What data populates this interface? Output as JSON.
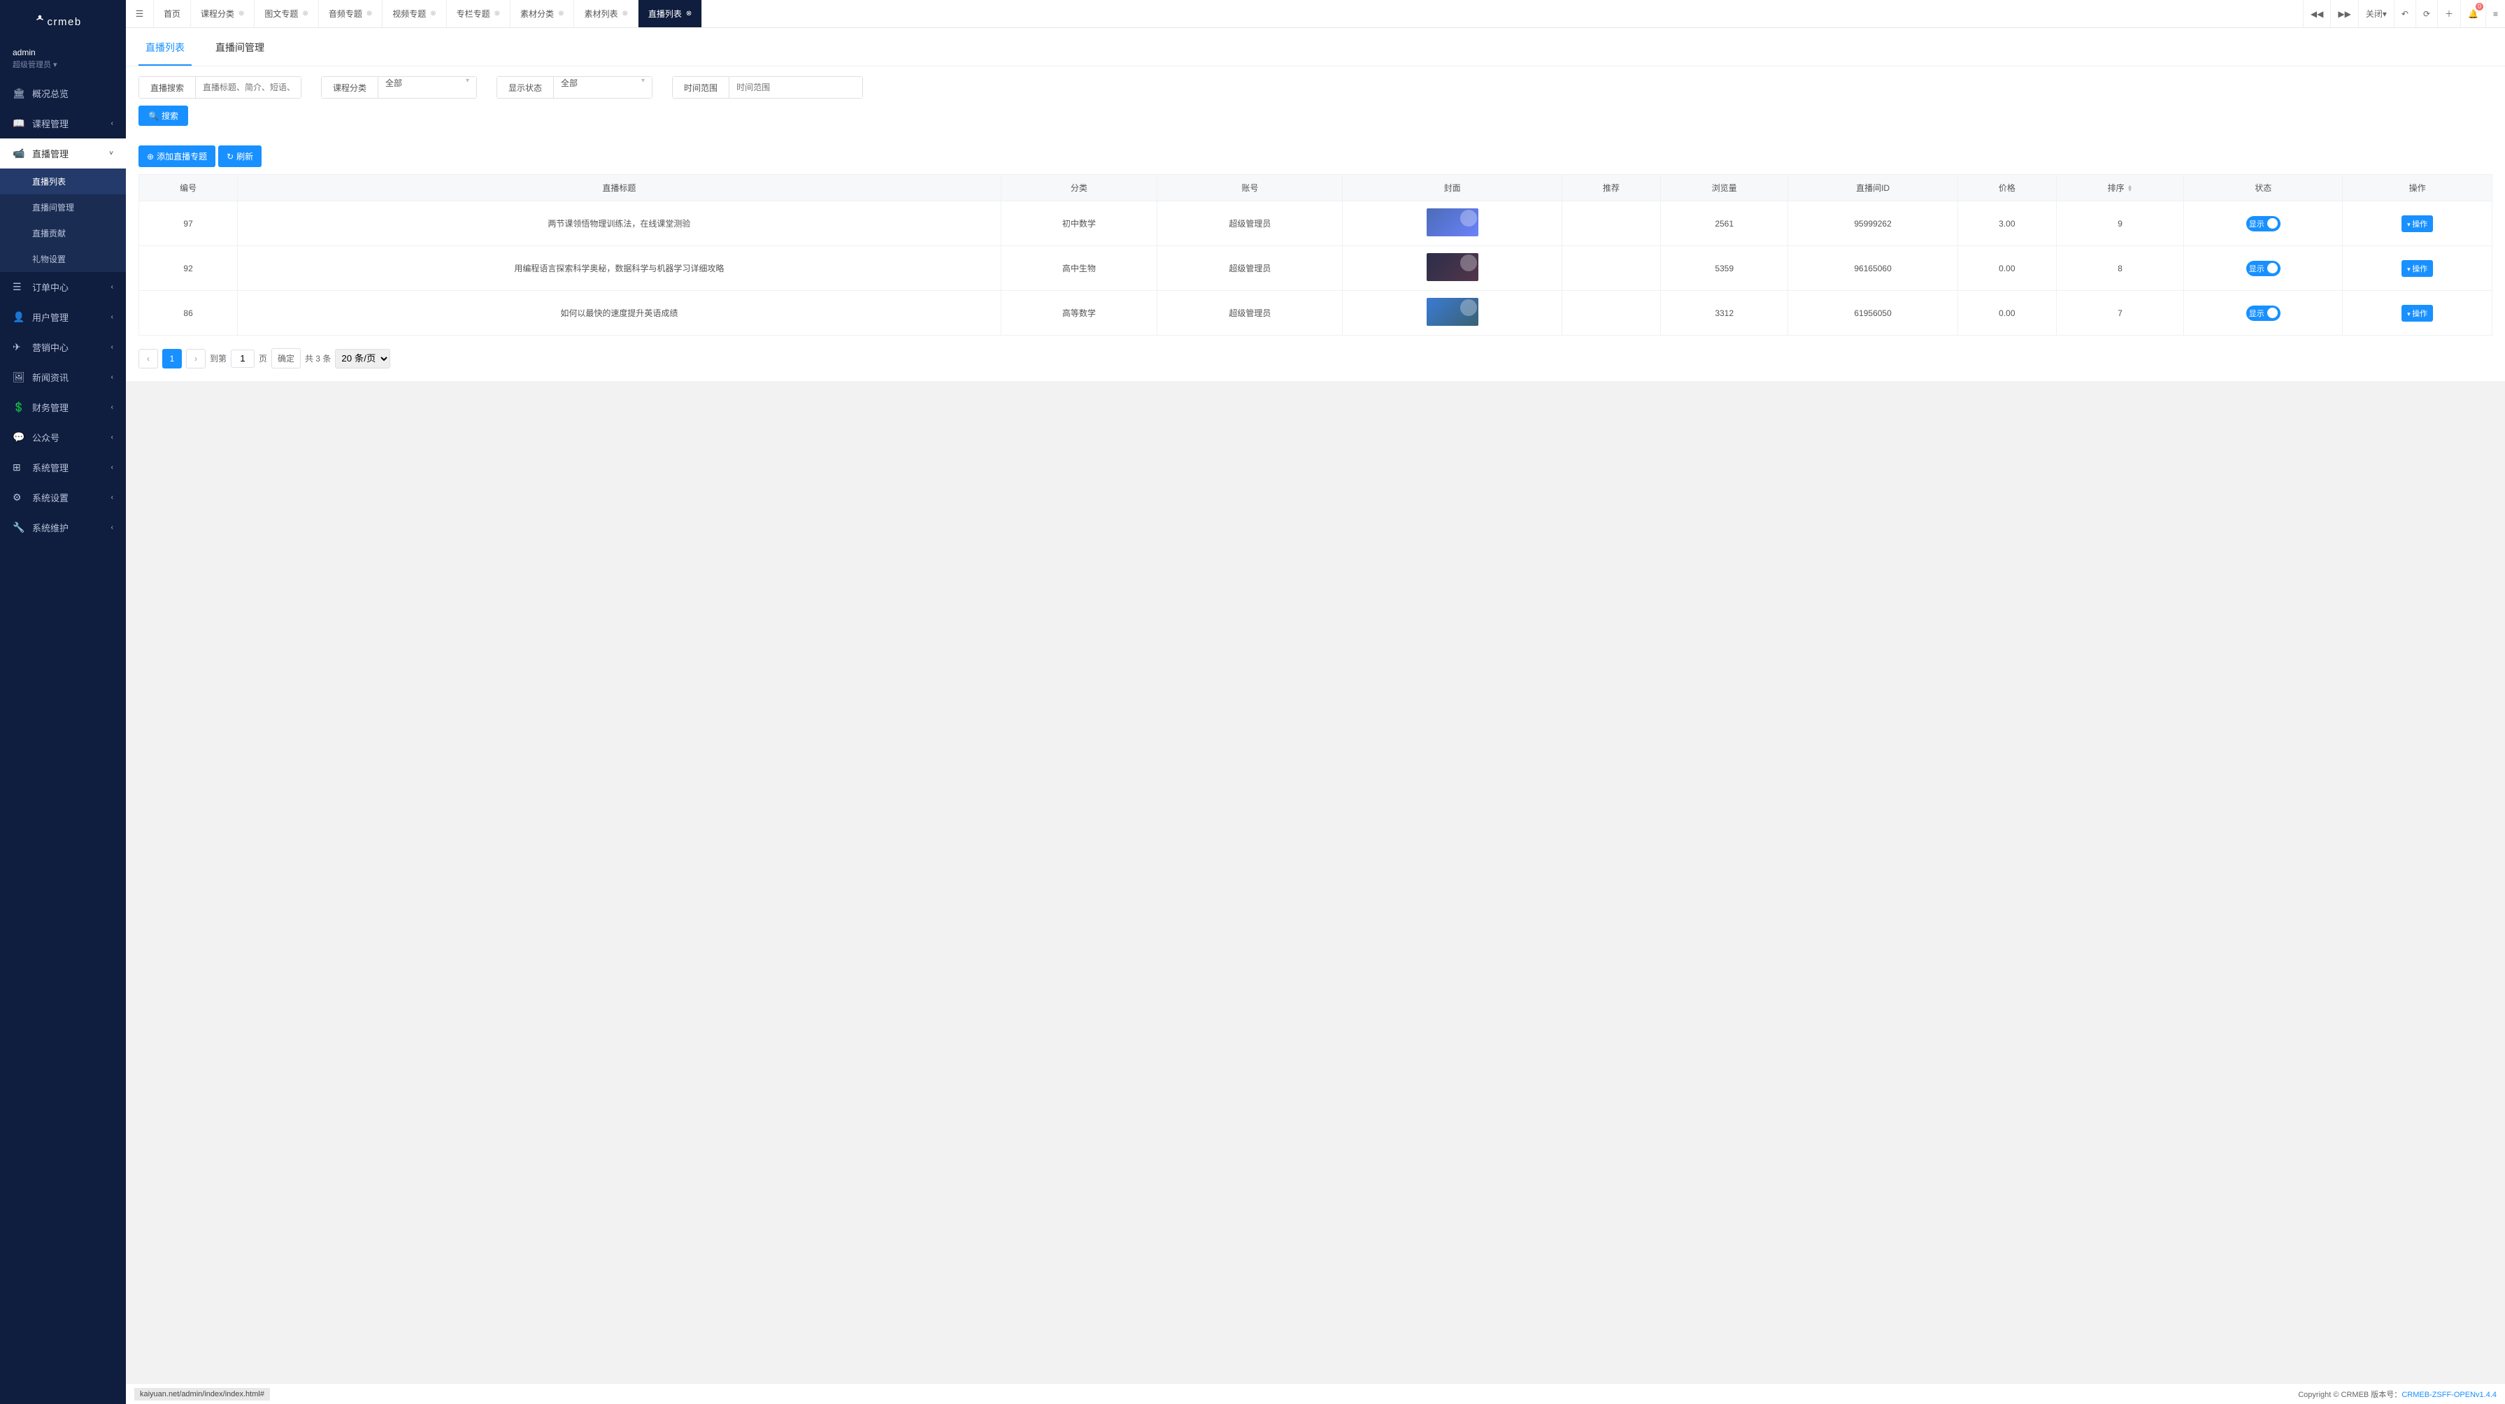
{
  "brand": "crmeb",
  "user": {
    "name": "admin",
    "role": "超级管理员"
  },
  "sidebar": [
    {
      "icon": "bank",
      "label": "概况总览",
      "sub": null
    },
    {
      "icon": "book",
      "label": "课程管理",
      "sub": null,
      "chev": true
    },
    {
      "icon": "video",
      "label": "直播管理",
      "sub": [
        "直播列表",
        "直播间管理",
        "直播贡献",
        "礼物设置"
      ],
      "expanded": true,
      "activeSub": 0
    },
    {
      "icon": "list",
      "label": "订单中心",
      "sub": null,
      "chev": true
    },
    {
      "icon": "user",
      "label": "用户管理",
      "sub": null,
      "chev": true
    },
    {
      "icon": "send",
      "label": "营销中心",
      "sub": null,
      "chev": true
    },
    {
      "icon": "image",
      "label": "新闻资讯",
      "sub": null,
      "chev": true
    },
    {
      "icon": "money",
      "label": "财务管理",
      "sub": null,
      "chev": true
    },
    {
      "icon": "wechat",
      "label": "公众号",
      "sub": null,
      "chev": true
    },
    {
      "icon": "grid",
      "label": "系统管理",
      "sub": null,
      "chev": true
    },
    {
      "icon": "gear",
      "label": "系统设置",
      "sub": null,
      "chev": true
    },
    {
      "icon": "wrench",
      "label": "系统维护",
      "sub": null,
      "chev": true
    }
  ],
  "topTabs": [
    {
      "label": "首页",
      "closable": false
    },
    {
      "label": "课程分类",
      "closable": true
    },
    {
      "label": "图文专题",
      "closable": true
    },
    {
      "label": "音频专题",
      "closable": true
    },
    {
      "label": "视频专题",
      "closable": true
    },
    {
      "label": "专栏专题",
      "closable": true
    },
    {
      "label": "素材分类",
      "closable": true
    },
    {
      "label": "素材列表",
      "closable": true
    },
    {
      "label": "直播列表",
      "closable": true,
      "active": true
    }
  ],
  "topTools": {
    "close": "关闭",
    "bellCount": "0"
  },
  "innerTabs": [
    "直播列表",
    "直播间管理"
  ],
  "filters": {
    "searchLabel": "直播搜索",
    "searchPlaceholder": "直播标题、简介、短语、编号",
    "categoryLabel": "课程分类",
    "categoryValue": "全部",
    "statusLabel": "显示状态",
    "statusValue": "全部",
    "timeLabel": "时间范围",
    "timePlaceholder": "时间范围",
    "searchBtn": "搜索"
  },
  "actions": {
    "add": "添加直播专题",
    "refresh": "刷新"
  },
  "columns": [
    "编号",
    "直播标题",
    "分类",
    "账号",
    "封面",
    "推荐",
    "浏览量",
    "直播间ID",
    "价格",
    "排序",
    "状态",
    "操作"
  ],
  "rows": [
    {
      "id": "97",
      "title": "两节课领悟物理训练法，在线课堂测验",
      "cat": "初中数学",
      "acct": "超级管理员",
      "cover": "c1",
      "recommend": "",
      "views": "2561",
      "room": "95999262",
      "price": "3.00",
      "sort": "9",
      "state": "显示",
      "op": "操作"
    },
    {
      "id": "92",
      "title": "用编程语言探索科学奥秘，数据科学与机器学习详细攻略",
      "cat": "高中生物",
      "acct": "超级管理员",
      "cover": "c2",
      "recommend": "",
      "views": "5359",
      "room": "96165060",
      "price": "0.00",
      "sort": "8",
      "state": "显示",
      "op": "操作"
    },
    {
      "id": "86",
      "title": "如何以最快的速度提升英语成绩",
      "cat": "高等数学",
      "acct": "超级管理员",
      "cover": "c3",
      "recommend": "",
      "views": "3312",
      "room": "61956050",
      "price": "0.00",
      "sort": "7",
      "state": "显示",
      "op": "操作"
    }
  ],
  "pagination": {
    "gotoLabel": "到第",
    "pageUnit": "页",
    "confirm": "确定",
    "total": "共 3 条",
    "perPage": "20 条/页",
    "current": "1"
  },
  "footer": {
    "status": "kaiyuan.net/admin/index/index.html#",
    "copyright": "Copyright © CRMEB 版本号：",
    "version": "CRMEB-ZSFF-OPENv1.4.4"
  }
}
